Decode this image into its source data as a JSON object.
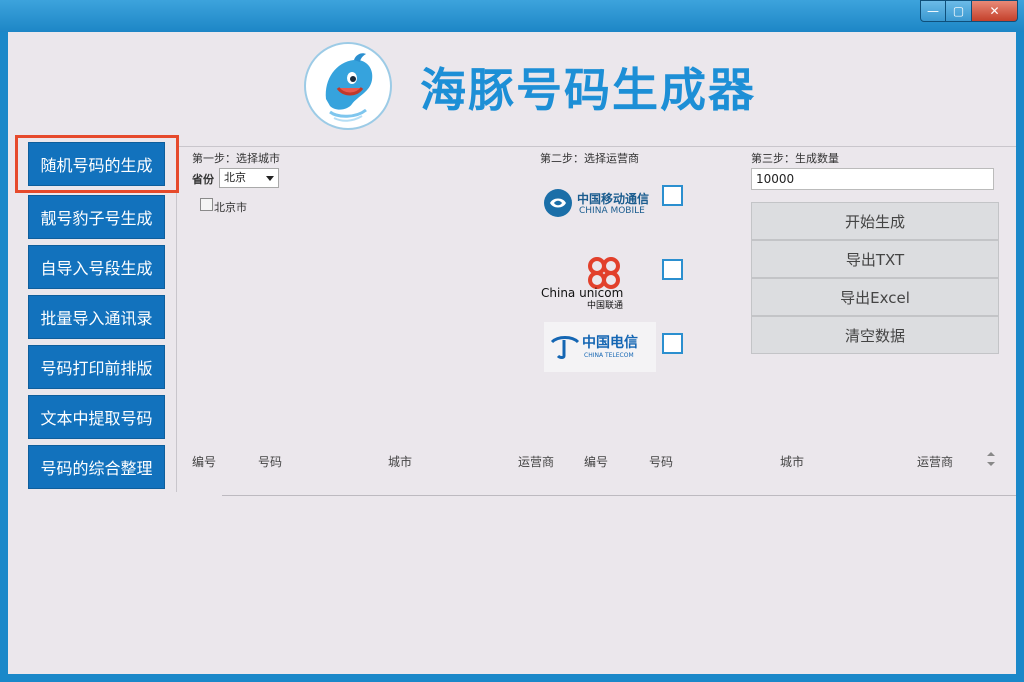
{
  "app": {
    "title": "海豚号码生成器",
    "accent_color": "#1d8fd6",
    "nav_color": "#1272bd"
  },
  "window_controls": {
    "minimize": "—",
    "maximize": "▢",
    "close": "✕"
  },
  "sidebar": {
    "items": [
      {
        "label": "随机号码的生成",
        "selected": true
      },
      {
        "label": "靓号豹子号生成"
      },
      {
        "label": "自导入号段生成"
      },
      {
        "label": "批量导入通讯录"
      },
      {
        "label": "号码打印前排版"
      },
      {
        "label": "文本中提取号码"
      },
      {
        "label": "号码的综合整理"
      }
    ]
  },
  "step1": {
    "label": "第一步：选择城市",
    "province_label": "省份",
    "province_value": "北京",
    "city_checkbox_label": "北京市"
  },
  "step2": {
    "label": "第二步：选择运营商",
    "carriers": [
      {
        "name_cn": "中国移动通信",
        "name_en": "CHINA MOBILE"
      },
      {
        "name_cn": "中国联通",
        "name_en": "China unicom"
      },
      {
        "name_cn": "中国电信",
        "name_en": "CHINA TELECOM"
      }
    ]
  },
  "step3": {
    "label": "第三步：生成数量",
    "quantity": "10000"
  },
  "actions": {
    "start": "开始生成",
    "export_txt": "导出TXT",
    "export_excel": "导出Excel",
    "clear": "清空数据"
  },
  "table": {
    "columns": [
      "编号",
      "号码",
      "城市",
      "运营商",
      "编号",
      "号码",
      "城市",
      "运营商"
    ]
  }
}
